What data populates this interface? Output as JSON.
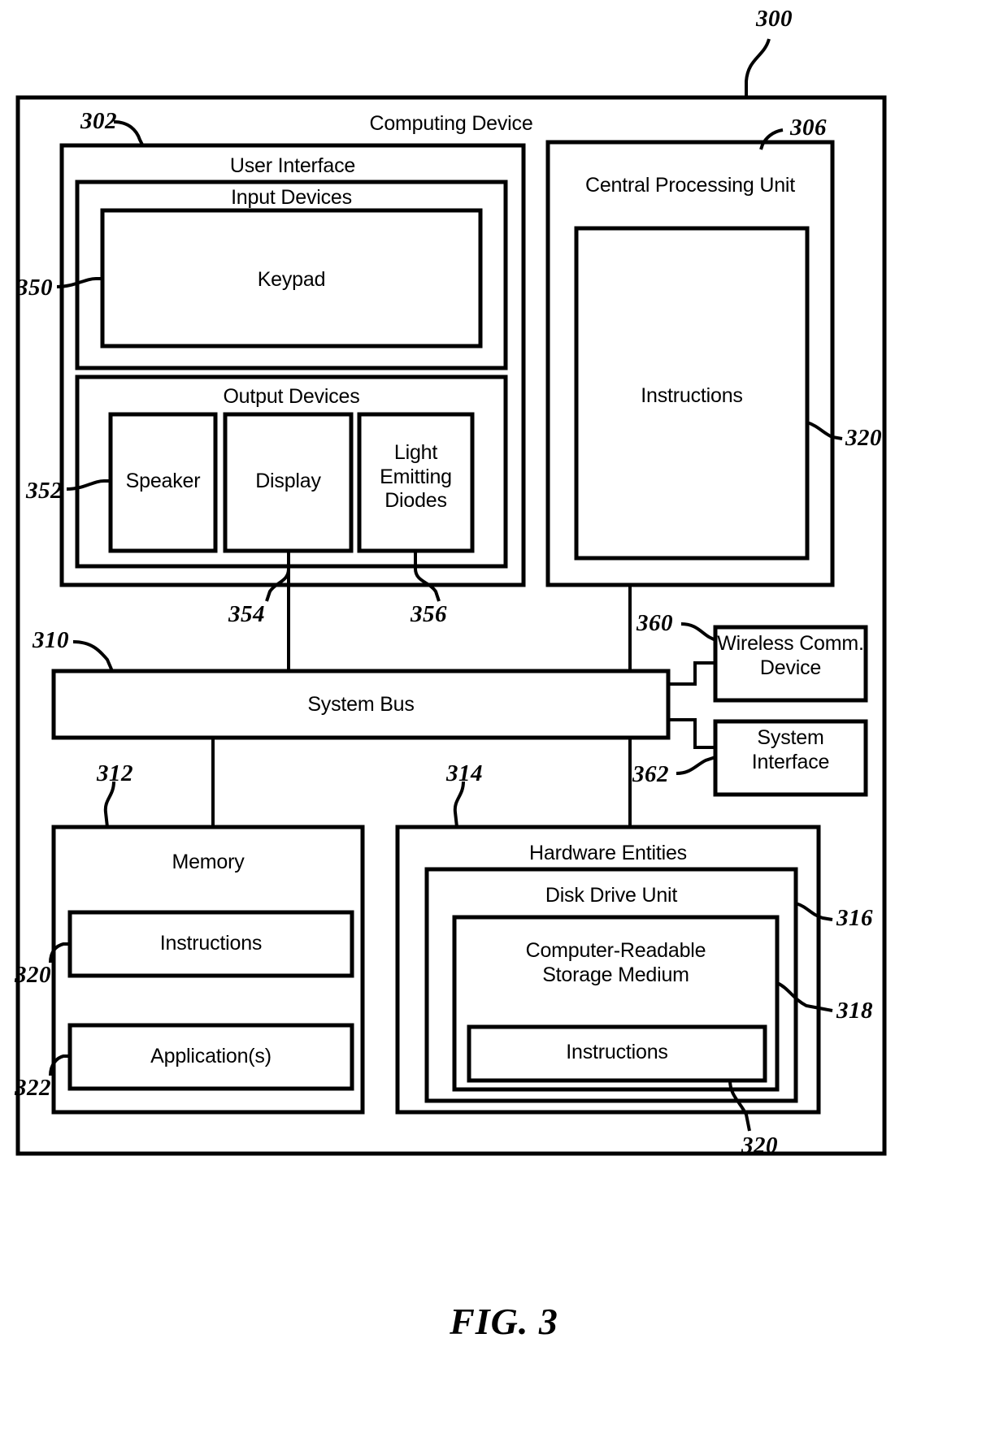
{
  "figure": {
    "caption": "FIG. 3",
    "top_reference": "300"
  },
  "diagram": {
    "type": "patent-block-diagram",
    "outer_block": {
      "title": "Computing Device",
      "reference": "300"
    },
    "blocks": [
      {
        "id": "user-interface",
        "title": "User Interface",
        "reference": "302"
      },
      {
        "id": "input-devices",
        "title": "Input Devices",
        "reference": ""
      },
      {
        "id": "keypad",
        "title": "Keypad",
        "reference": "350"
      },
      {
        "id": "output-devices",
        "title": "Output Devices",
        "reference": ""
      },
      {
        "id": "speaker",
        "title": "Speaker",
        "reference": "352"
      },
      {
        "id": "display",
        "title": "Display",
        "reference": "354"
      },
      {
        "id": "light-emitting-diodes",
        "title": "Light\nEmitting\nDiodes",
        "reference": "356"
      },
      {
        "id": "central-processing-unit",
        "title": "Central Processing Unit",
        "reference": "306"
      },
      {
        "id": "cpu-instructions",
        "title": "Instructions",
        "reference": "320"
      },
      {
        "id": "system-bus",
        "title": "System Bus",
        "reference": "310"
      },
      {
        "id": "wireless-comm-device",
        "title": "Wireless Comm.\nDevice",
        "reference": "360"
      },
      {
        "id": "system-interface",
        "title": "System\nInterface",
        "reference": "362"
      },
      {
        "id": "memory",
        "title": "Memory",
        "reference": "312"
      },
      {
        "id": "memory-instructions",
        "title": "Instructions",
        "reference": "320"
      },
      {
        "id": "applications",
        "title": "Application(s)",
        "reference": "322"
      },
      {
        "id": "hardware-entities",
        "title": "Hardware Entities",
        "reference": "314"
      },
      {
        "id": "disk-drive-unit",
        "title": "Disk Drive Unit",
        "reference": "316"
      },
      {
        "id": "computer-readable-storage-medium",
        "title": "Computer-Readable\nStorage Medium",
        "reference": "318"
      },
      {
        "id": "storage-instructions",
        "title": "Instructions",
        "reference": "320"
      }
    ]
  },
  "labels": {
    "computing_device": "Computing Device",
    "user_interface": "User Interface",
    "input_devices": "Input Devices",
    "keypad": "Keypad",
    "output_devices": "Output Devices",
    "speaker": "Speaker",
    "display": "Display",
    "leds": "Light\nEmitting\nDiodes",
    "cpu": "Central Processing Unit",
    "cpu_instructions": "Instructions",
    "system_bus": "System Bus",
    "wireless_comm_device": "Wireless Comm.\nDevice",
    "system_interface": "System\nInterface",
    "memory": "Memory",
    "memory_instructions": "Instructions",
    "applications": "Application(s)",
    "hardware_entities": "Hardware Entities",
    "disk_drive_unit": "Disk Drive Unit",
    "crsm": "Computer-Readable\nStorage Medium",
    "storage_instructions": "Instructions"
  },
  "references": {
    "r300": "300",
    "r302": "302",
    "r306": "306",
    "r310": "310",
    "r312": "312",
    "r314": "314",
    "r316": "316",
    "r318": "318",
    "r320_cpu": "320",
    "r320_mem": "320",
    "r320_storage": "320",
    "r322": "322",
    "r350": "350",
    "r352": "352",
    "r354": "354",
    "r356": "356",
    "r360": "360",
    "r362": "362"
  },
  "colors": {
    "line": "#000000",
    "background": "#ffffff",
    "text": "#000000"
  }
}
